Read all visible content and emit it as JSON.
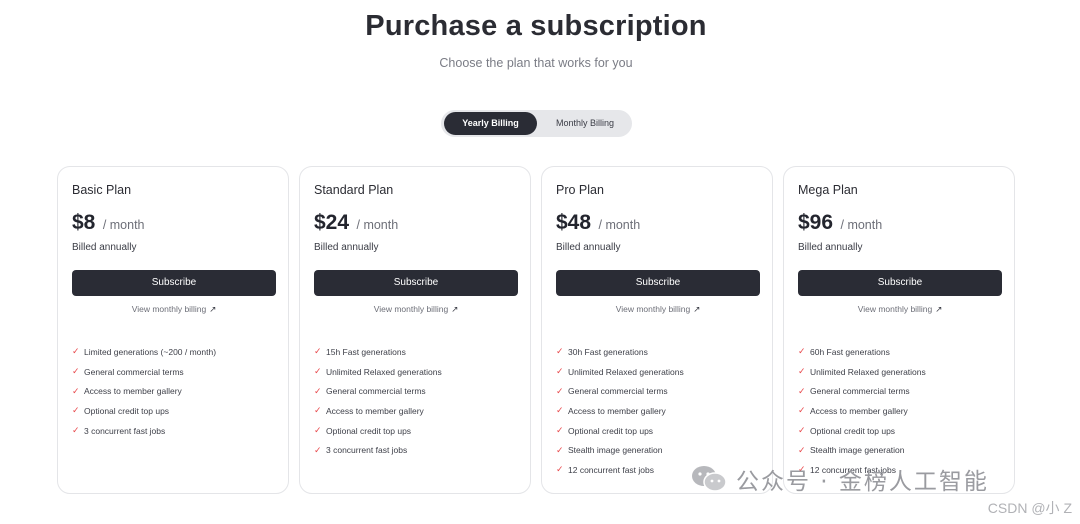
{
  "header": {
    "title": "Purchase a subscription",
    "subtitle": "Choose the plan that works for you"
  },
  "billing_toggle": {
    "yearly_label": "Yearly Billing",
    "monthly_label": "Monthly Billing",
    "selected": "Yearly Billing"
  },
  "plans": [
    {
      "name": "Basic Plan",
      "price": "$8",
      "period": "/ month",
      "billed": "Billed annually",
      "subscribe_label": "Subscribe",
      "monthly_link": "View monthly billing",
      "features": [
        "Limited generations (~200 / month)",
        "General commercial terms",
        "Access to member gallery",
        "Optional credit top ups",
        "3 concurrent fast jobs"
      ]
    },
    {
      "name": "Standard Plan",
      "price": "$24",
      "period": "/ month",
      "billed": "Billed annually",
      "subscribe_label": "Subscribe",
      "monthly_link": "View monthly billing",
      "features": [
        "15h Fast generations",
        "Unlimited Relaxed generations",
        "General commercial terms",
        "Access to member gallery",
        "Optional credit top ups",
        "3 concurrent fast jobs"
      ]
    },
    {
      "name": "Pro Plan",
      "price": "$48",
      "period": "/ month",
      "billed": "Billed annually",
      "subscribe_label": "Subscribe",
      "monthly_link": "View monthly billing",
      "features": [
        "30h Fast generations",
        "Unlimited Relaxed generations",
        "General commercial terms",
        "Access to member gallery",
        "Optional credit top ups",
        "Stealth image generation",
        "12 concurrent fast jobs"
      ]
    },
    {
      "name": "Mega Plan",
      "price": "$96",
      "period": "/ month",
      "billed": "Billed annually",
      "subscribe_label": "Subscribe",
      "monthly_link": "View monthly billing",
      "features": [
        "60h Fast generations",
        "Unlimited Relaxed generations",
        "General commercial terms",
        "Access to member gallery",
        "Optional credit top ups",
        "Stealth image generation",
        "12 concurrent fast jobs"
      ]
    }
  ],
  "icons": {
    "check": "check-icon",
    "link_arrow": "arrow-up-right-icon"
  },
  "colors": {
    "accent_dark": "#2a2c35",
    "check_red": "#e8474a"
  },
  "watermark": {
    "text": "公众号 · 金榜人工智能",
    "csdn": "CSDN @小 Z"
  }
}
